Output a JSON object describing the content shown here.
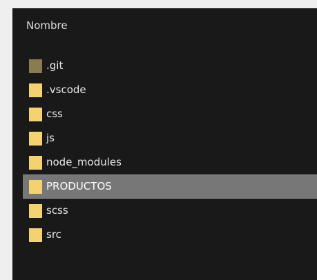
{
  "header": {
    "column_name": "Nombre"
  },
  "icons": {
    "folder": "folder-icon",
    "hidden_folder": "hidden-folder-icon"
  },
  "colors": {
    "background": "#191919",
    "selection": "#777777",
    "folder": "#f5d271",
    "hidden_folder": "#8a7b50"
  },
  "items": [
    {
      "label": ".git",
      "hidden": true,
      "selected": false
    },
    {
      "label": ".vscode",
      "hidden": false,
      "selected": false
    },
    {
      "label": "css",
      "hidden": false,
      "selected": false
    },
    {
      "label": "js",
      "hidden": false,
      "selected": false
    },
    {
      "label": "node_modules",
      "hidden": false,
      "selected": false
    },
    {
      "label": "PRODUCTOS",
      "hidden": false,
      "selected": true
    },
    {
      "label": "scss",
      "hidden": false,
      "selected": false
    },
    {
      "label": "src",
      "hidden": false,
      "selected": false
    }
  ]
}
